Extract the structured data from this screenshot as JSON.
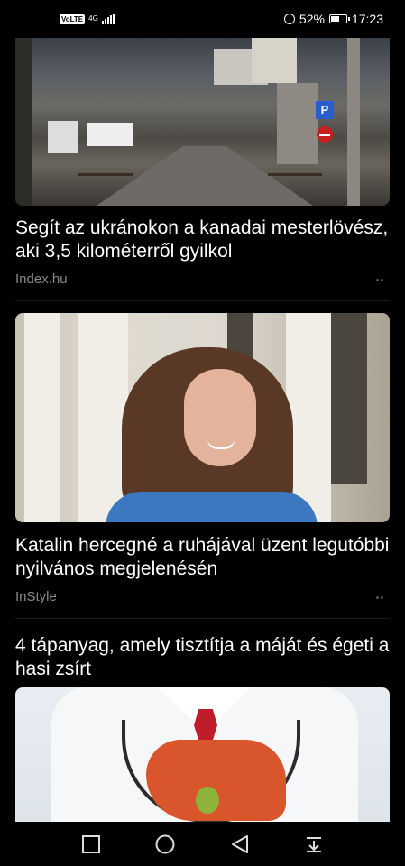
{
  "status_bar": {
    "volte": "VoLTE",
    "network": "4G",
    "battery_percent": "52%",
    "battery_level": 0.52,
    "time": "17:23"
  },
  "articles": [
    {
      "title": "Segít az ukránokon a kanadai mesterlövész, aki 3,5 kilométerről gyilkol",
      "source": "Index.hu",
      "image": "war-street-image"
    },
    {
      "title": "Katalin hercegné a ruhájával üzent legutóbbi nyilvános megjelenésén",
      "source": "InStyle",
      "image": "portrait-image"
    },
    {
      "title": "4 tápanyag, amely tisztítja a máját és égeti a hasi zsírt",
      "image": "liver-doctor-image"
    }
  ],
  "navigation": {
    "icons": [
      "square-recents-icon",
      "circle-home-icon",
      "triangle-back-icon",
      "pull-down-icon"
    ]
  },
  "colors": {
    "background": "#000000",
    "headline": "#ffffff",
    "source": "#8a8a8a"
  }
}
